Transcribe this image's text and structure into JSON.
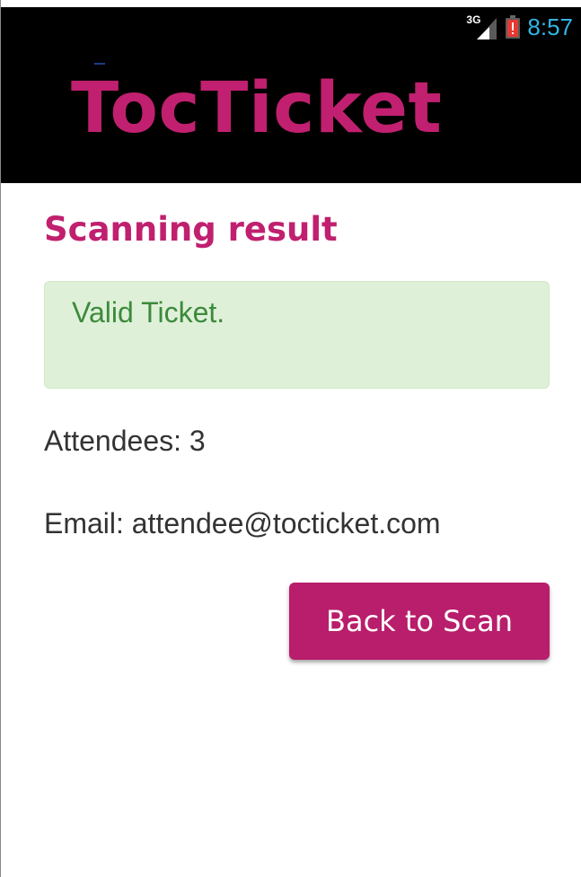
{
  "status_bar": {
    "network_label": "3G",
    "time": "8:57",
    "icons": [
      "signal-icon",
      "battery-alert-icon"
    ],
    "clock_color": "#33b5e5",
    "battery_color": "#e53935"
  },
  "header": {
    "logo_text": "TocTicket",
    "brand_color": "#c0206f"
  },
  "main": {
    "title": "Scanning result",
    "result_message": "Valid Ticket.",
    "attendees_text": "Attendees: 3",
    "email_text": "Email: attendee@tocticket.com",
    "back_button_label": "Back to Scan",
    "colors": {
      "success_bg": "#dff0d8",
      "success_text": "#3c8a3c",
      "button_bg": "#b81e6b"
    }
  }
}
